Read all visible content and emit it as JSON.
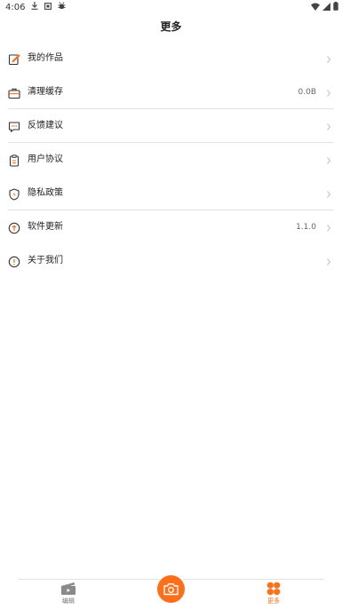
{
  "status_bar": {
    "time": "4:06",
    "left_icons": [
      "download-icon",
      "media-icon",
      "bug-icon"
    ],
    "right_icons": [
      "wifi-icon",
      "signal-icon",
      "battery-icon"
    ]
  },
  "header": {
    "title": "更多"
  },
  "menu": {
    "items": [
      {
        "label": "我的作品",
        "value": "",
        "icon": "edit-note-icon"
      },
      {
        "label": "清理缓存",
        "value": "0.0B",
        "icon": "briefcase-icon"
      },
      {
        "label": "反馈建议",
        "value": "",
        "icon": "feedback-icon"
      },
      {
        "label": "用户协议",
        "value": "",
        "icon": "clipboard-icon"
      },
      {
        "label": "隐私政策",
        "value": "",
        "icon": "shield-icon"
      },
      {
        "label": "软件更新",
        "value": "1.1.0",
        "icon": "upgrade-icon"
      },
      {
        "label": "关于我们",
        "value": "",
        "icon": "info-icon"
      }
    ],
    "accent_color": "#ff6f1a"
  },
  "tabbar": {
    "tabs": [
      {
        "label": "编辑",
        "icon": "clapperboard-icon",
        "active": false
      },
      {
        "label": "",
        "icon": "camera-icon",
        "active": false
      },
      {
        "label": "更多",
        "icon": "grid-flower-icon",
        "active": true
      }
    ],
    "active_color": "#ff6f1a",
    "inactive_color": "#777777"
  }
}
